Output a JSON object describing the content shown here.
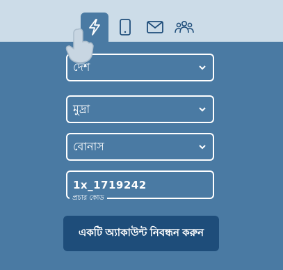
{
  "tabs": [
    {
      "icon": "lightning-icon",
      "active": true
    },
    {
      "icon": "phone-icon",
      "active": false
    },
    {
      "icon": "mail-icon",
      "active": false
    },
    {
      "icon": "people-icon",
      "active": false
    }
  ],
  "form": {
    "country": {
      "value": "দেশ"
    },
    "currency": {
      "value": "মুদ্রা"
    },
    "bonus": {
      "value": "বোনাস"
    },
    "promo": {
      "value": "1x_1719242",
      "caption": "প্রচার কোড"
    },
    "submit_label": "একটি অ্যাকাউন্ট নিবন্ধন করুন"
  },
  "colors": {
    "background": "#4a7aa3",
    "topbar": "#ccdce8",
    "button": "#1e4d7a",
    "icon": "#1e4d7a"
  }
}
